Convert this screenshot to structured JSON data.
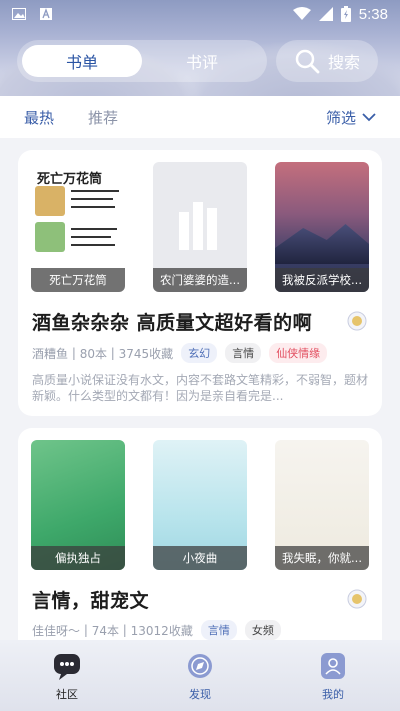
{
  "status_bar": {
    "time": "5:38"
  },
  "top_tabs": {
    "active": "书单",
    "inactive": "书评",
    "search_label": "搜索"
  },
  "filter": {
    "hot": "最热",
    "recommend": "推荐",
    "screen": "筛选"
  },
  "cards": [
    {
      "covers": [
        "死亡万花筒",
        "农门婆婆的造...",
        "我被反派学校..."
      ],
      "cover1_art_title": "死亡万花筒",
      "title": "酒鱼杂杂杂 高质量文超好看的啊",
      "author": "酒糟鱼",
      "count": "80本",
      "fav": "3745收藏",
      "tags": [
        "玄幻",
        "言情",
        "仙侠情缘"
      ],
      "desc": "高质量小说保证没有水文，内容不套路文笔精彩，不弱智，题材新颖。什么类型的文都有！因为是亲自看完是..."
    },
    {
      "covers": [
        "偏执独占",
        "小夜曲",
        "我失眠，你就..."
      ],
      "title": "言情，甜宠文",
      "author": "佳佳呀～",
      "count": "74本",
      "fav": "13012收藏",
      "tags": [
        "言情",
        "女频"
      ]
    }
  ],
  "bottom_nav": [
    "社区",
    "发现",
    "我的"
  ],
  "colors": {
    "accent": "#3a5ea8",
    "tag_red": "#e24d5f"
  }
}
